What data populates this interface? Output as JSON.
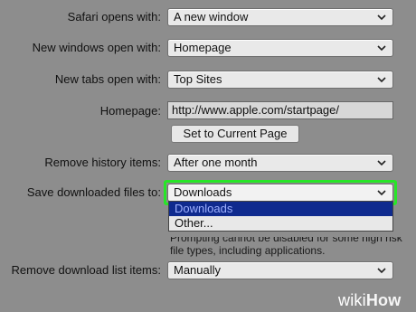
{
  "rows": {
    "safari_opens": {
      "label": "Safari opens with:",
      "value": "A new window"
    },
    "new_windows": {
      "label": "New windows open with:",
      "value": "Homepage"
    },
    "new_tabs": {
      "label": "New tabs open with:",
      "value": "Top Sites"
    },
    "homepage": {
      "label": "Homepage:",
      "value": "http://www.apple.com/startpage/"
    },
    "set_current_page": "Set to Current Page",
    "remove_history": {
      "label": "Remove history items:",
      "value": "After one month"
    },
    "save_downloads": {
      "label": "Save downloaded files to:",
      "value": "Downloads",
      "options": [
        "Downloads",
        "Other..."
      ]
    },
    "hint_text": "Prompting cannot be disabled for some high risk file types, including applications.",
    "remove_download_list": {
      "label": "Remove download list items:",
      "value": "Manually"
    }
  },
  "watermark": {
    "prefix": "wiki",
    "suffix": "How"
  },
  "colors": {
    "focus": "#27e627",
    "selected_option": "#0f2a8e",
    "background": "#8d8d8d"
  }
}
